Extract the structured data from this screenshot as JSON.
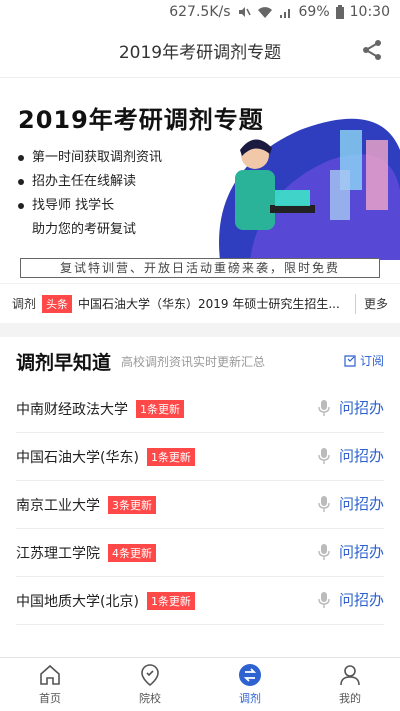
{
  "status_bar": {
    "speed": "627.5K/s",
    "battery": "69%",
    "time": "10:30"
  },
  "header": {
    "title": "2019年考研调剂专题",
    "share_icon": "share-icon"
  },
  "banner": {
    "title": "2019年考研调剂专题",
    "bullets": [
      "第一时间获取调剂资讯",
      "招办主任在线解读",
      "找导师  找学长"
    ],
    "tagline": "助力您的考研复试",
    "promo": "复试特训营、开放日活动重磅来袭，限时免费"
  },
  "ticker": {
    "prefix": "调剂",
    "tag": "头条",
    "text": "中国石油大学（华东）2019 年硕士研究生招生...",
    "more": "更多"
  },
  "section": {
    "title": "调剂早知道",
    "subtitle": "高校调剂资讯实时更新汇总",
    "subscribe": "订阅"
  },
  "schools": [
    {
      "name": "中南财经政法大学",
      "badge": "1条更新",
      "action": "问招办"
    },
    {
      "name": "中国石油大学(华东)",
      "badge": "1条更新",
      "action": "问招办"
    },
    {
      "name": "南京工业大学",
      "badge": "3条更新",
      "action": "问招办"
    },
    {
      "name": "江苏理工学院",
      "badge": "4条更新",
      "action": "问招办"
    },
    {
      "name": "中国地质大学(北京)",
      "badge": "1条更新",
      "action": "问招办"
    }
  ],
  "tabs": [
    {
      "label": "首页",
      "icon": "home-icon"
    },
    {
      "label": "院校",
      "icon": "location-pin-icon"
    },
    {
      "label": "调剂",
      "icon": "swap-icon",
      "active": true
    },
    {
      "label": "我的",
      "icon": "user-icon"
    }
  ],
  "colors": {
    "accent": "#2d62d0",
    "badge": "#ff4848"
  }
}
